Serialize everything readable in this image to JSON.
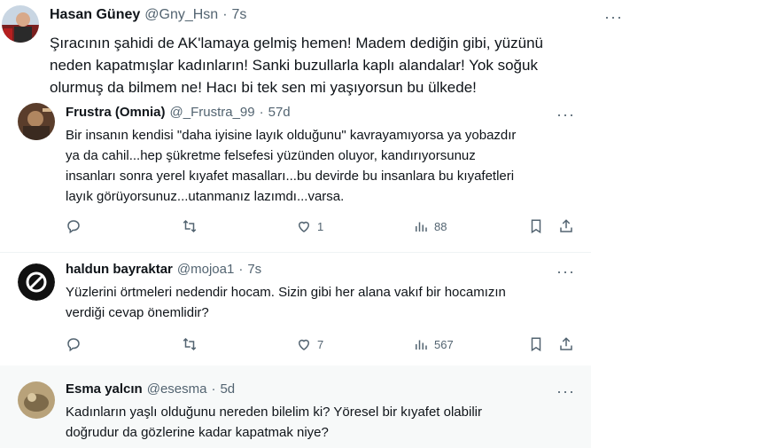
{
  "main_tweet": {
    "name": "Hasan Güney",
    "handle": "@Gny_Hsn",
    "dot": "·",
    "time": "7s",
    "lines": [
      "Şıracının şahidi de AK'lamaya gelmiş hemen! Madem dediğin gibi, yüzünü",
      "neden kapatmışlar kadınların! Sanki buzullarla kaplı alandalar! Yok soğuk",
      "olurmuş da bilmem ne! Hacı bi tek sen mi yaşıyorsun bu ülkede!"
    ],
    "more": "···"
  },
  "replies": [
    {
      "name": "Frustra (Omnia)",
      "handle": "@_Frustra_99",
      "dot": "·",
      "time": "57d",
      "more": "···",
      "lines": [
        "Bir insanın kendisi \"daha iyisine layık olduğunu\" kavrayamıyorsa ya yobazdır",
        "ya da cahil...hep şükretme felsefesi yüzünden oluyor, kandırıyorsunuz",
        "insanları sonra yerel kıyafet masalları...bu devirde bu insanlara bu kıyafetleri",
        "layık görüyorsunuz...utanmanız lazımdı...varsa."
      ],
      "likes": "1",
      "views": "88"
    },
    {
      "name": "haldun bayraktar",
      "handle": "@mojoa1",
      "dot": "·",
      "time": "7s",
      "more": "···",
      "lines": [
        "Yüzlerini örtmeleri nedendir hocam. Sizin gibi her alana vakıf bir hocamızın",
        "verdiği cevap önemlidir?"
      ],
      "likes": "7",
      "views": "567"
    },
    {
      "name": "Esma yalcın",
      "handle": "@esesma",
      "dot": "·",
      "time": "5d",
      "more": "···",
      "lines": [
        "Kadınların yaşlı olduğunu nereden bilelim ki? Yöresel bir kıyafet olabilir",
        "doğrudur da gözlerine kadar kapatmak niye?"
      ]
    }
  ],
  "colors": {
    "text": "#0f1419",
    "muted": "#536471",
    "hover_bg": "#f7f9f9",
    "divider": "#eff3f4"
  },
  "icons": [
    "reply-icon",
    "retweet-icon",
    "like-icon",
    "views-icon",
    "bookmark-icon",
    "share-icon",
    "more-icon"
  ]
}
